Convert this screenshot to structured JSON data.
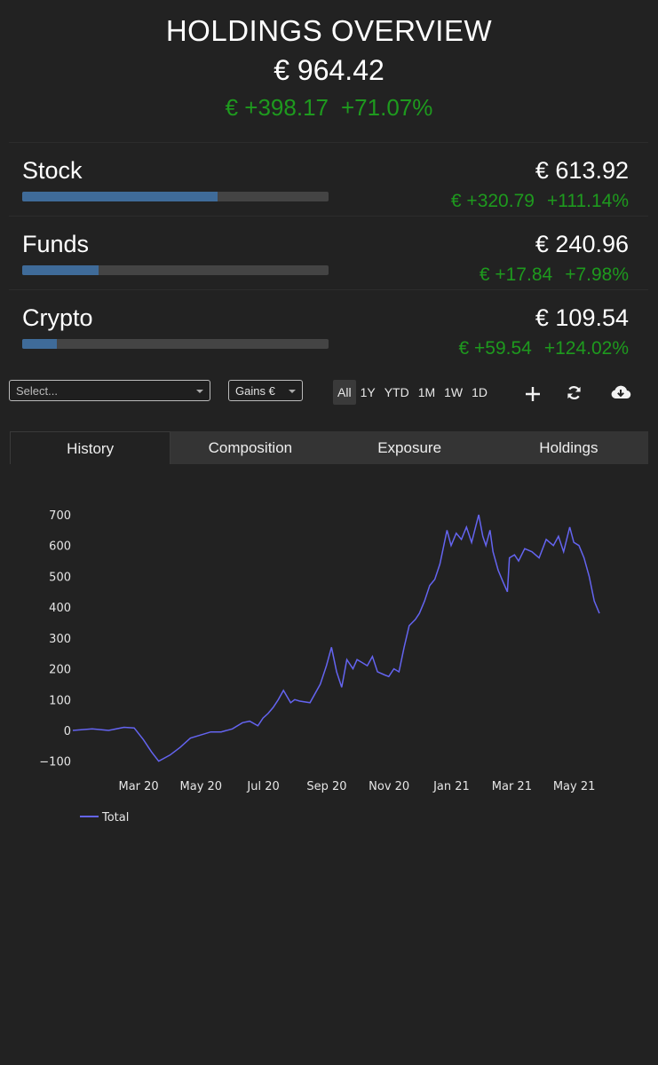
{
  "header": {
    "title": "HOLDINGS OVERVIEW",
    "total": "€ 964.42",
    "gain_abs": "€ +398.17",
    "gain_pct": "+71.07%"
  },
  "categories": [
    {
      "name": "Stock",
      "value": "€ 613.92",
      "gain_abs": "€ +320.79",
      "gain_pct": "+111.14%",
      "share": 0.637
    },
    {
      "name": "Funds",
      "value": "€ 240.96",
      "gain_abs": "€ +17.84",
      "gain_pct": "+7.98%",
      "share": 0.25
    },
    {
      "name": "Crypto",
      "value": "€ 109.54",
      "gain_abs": "€ +59.54",
      "gain_pct": "+124.02%",
      "share": 0.114
    }
  ],
  "toolbar": {
    "select_placeholder": "Select...",
    "mode": "Gains €",
    "ranges": [
      "All",
      "1Y",
      "YTD",
      "1M",
      "1W",
      "1D"
    ],
    "active_range": "All",
    "icons": [
      "plus-icon",
      "refresh-icon",
      "cloud-download-icon"
    ]
  },
  "tabs": [
    "History",
    "Composition",
    "Exposure",
    "Holdings"
  ],
  "active_tab": "History",
  "colors": {
    "background": "#222222",
    "gain": "#1e9a1e",
    "bar_fill": "#3f6b99",
    "line": "#6464f0"
  },
  "chart_data": {
    "type": "line",
    "x_tick_labels": [
      "Mar 20",
      "May 20",
      "Jul 20",
      "Sep 20",
      "Nov 20",
      "Jan 21",
      "Mar 21",
      "May 21"
    ],
    "y_ticks": [
      -100,
      0,
      100,
      200,
      300,
      400,
      500,
      600,
      700
    ],
    "ylim": [
      -120,
      720
    ],
    "legend": "bottom-left",
    "series": [
      {
        "name": "Total",
        "x": [
          "2020-01-01",
          "2020-01-20",
          "2020-02-05",
          "2020-02-20",
          "2020-03-01",
          "2020-03-10",
          "2020-03-18",
          "2020-03-25",
          "2020-04-05",
          "2020-04-15",
          "2020-04-25",
          "2020-05-05",
          "2020-05-15",
          "2020-05-25",
          "2020-06-05",
          "2020-06-15",
          "2020-06-22",
          "2020-06-30",
          "2020-07-05",
          "2020-07-10",
          "2020-07-15",
          "2020-07-20",
          "2020-07-25",
          "2020-08-01",
          "2020-08-05",
          "2020-08-10",
          "2020-08-20",
          "2020-08-30",
          "2020-09-05",
          "2020-09-10",
          "2020-09-15",
          "2020-09-20",
          "2020-09-25",
          "2020-10-01",
          "2020-10-05",
          "2020-10-10",
          "2020-10-15",
          "2020-10-20",
          "2020-10-25",
          "2020-11-01",
          "2020-11-05",
          "2020-11-10",
          "2020-11-15",
          "2020-11-20",
          "2020-11-25",
          "2020-12-01",
          "2020-12-05",
          "2020-12-10",
          "2020-12-15",
          "2020-12-20",
          "2020-12-25",
          "2021-01-01",
          "2021-01-05",
          "2021-01-10",
          "2021-01-15",
          "2021-01-20",
          "2021-01-25",
          "2021-02-01",
          "2021-02-05",
          "2021-02-08",
          "2021-02-12",
          "2021-02-15",
          "2021-02-20",
          "2021-02-25",
          "2021-03-01",
          "2021-03-03",
          "2021-03-08",
          "2021-03-12",
          "2021-03-18",
          "2021-03-25",
          "2021-04-01",
          "2021-04-08",
          "2021-04-15",
          "2021-04-20",
          "2021-04-25",
          "2021-05-01",
          "2021-05-05",
          "2021-05-10",
          "2021-05-15",
          "2021-05-20",
          "2021-05-25",
          "2021-05-30"
        ],
        "y": [
          0,
          5,
          0,
          10,
          8,
          -30,
          -70,
          -100,
          -80,
          -55,
          -25,
          -15,
          -5,
          -5,
          5,
          25,
          30,
          15,
          40,
          55,
          75,
          100,
          130,
          90,
          100,
          95,
          90,
          150,
          210,
          270,
          190,
          140,
          230,
          200,
          230,
          220,
          210,
          240,
          190,
          180,
          175,
          200,
          190,
          270,
          340,
          360,
          380,
          420,
          470,
          490,
          540,
          650,
          600,
          640,
          620,
          660,
          610,
          700,
          630,
          600,
          650,
          580,
          520,
          480,
          450,
          560,
          570,
          550,
          590,
          580,
          560,
          620,
          600,
          630,
          580,
          660,
          610,
          600,
          560,
          500,
          420,
          380
        ]
      }
    ]
  }
}
